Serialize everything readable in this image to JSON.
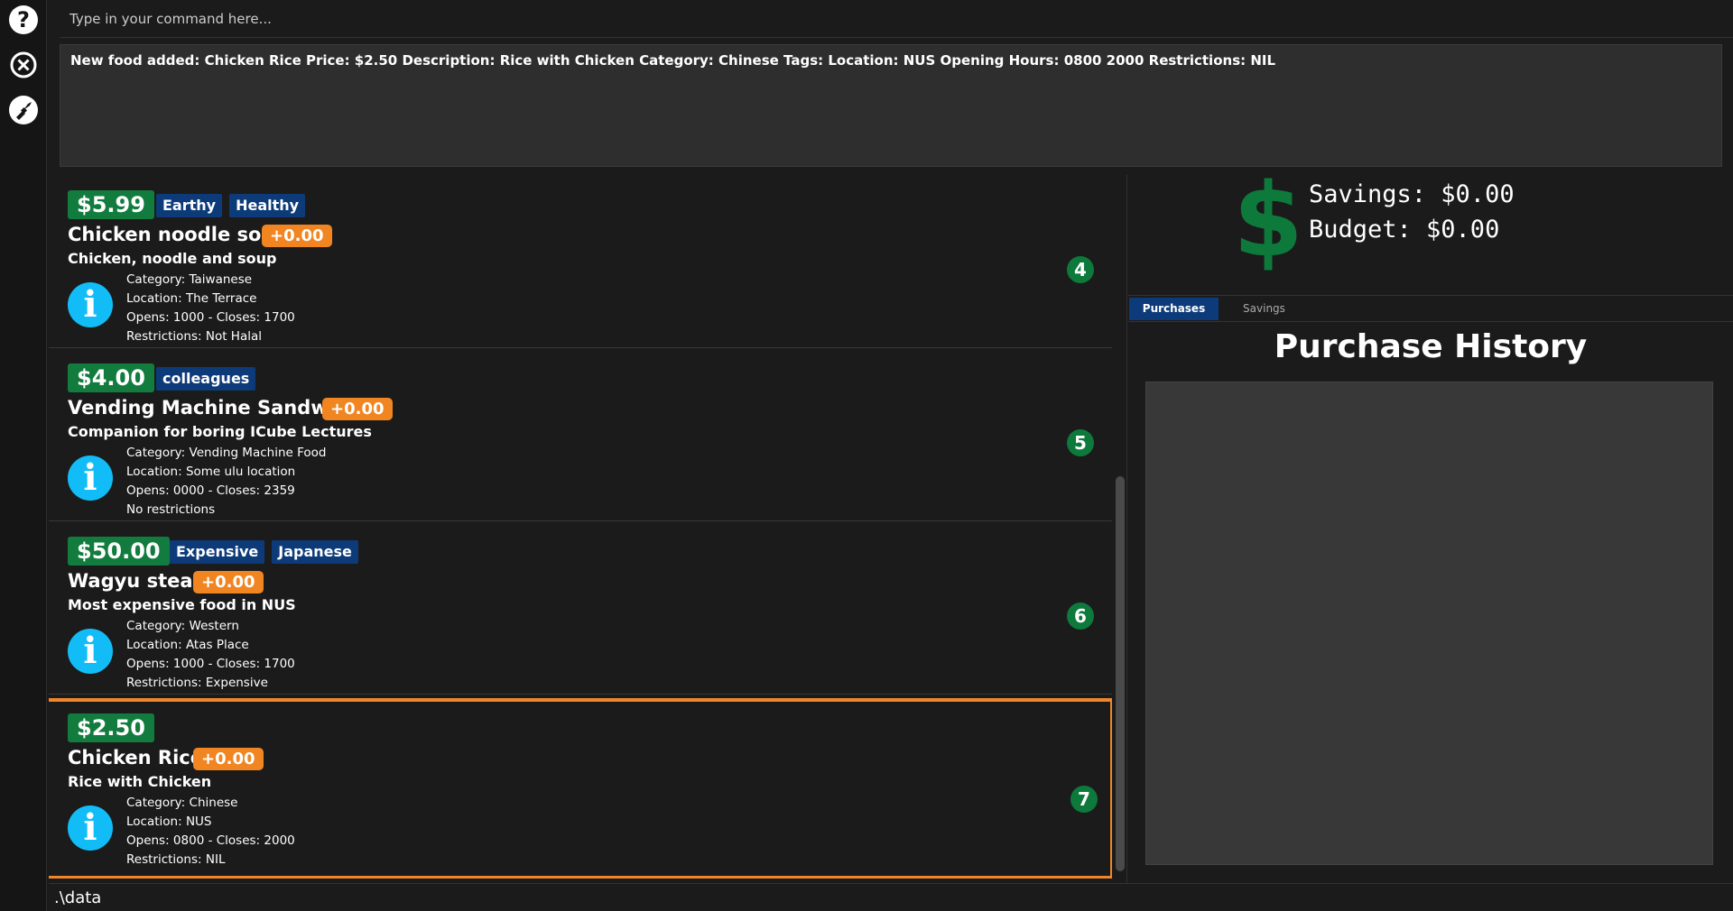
{
  "sidebar": {
    "help_glyph": "?",
    "icons": [
      "help-icon",
      "exit-icon",
      "theme-icon"
    ]
  },
  "command": {
    "placeholder": "Type in your command here..."
  },
  "result": {
    "text": "New food added: Chicken Rice Price: $2.50 Description: Rice with Chicken Category: Chinese Tags:  Location: NUS Opening Hours: 0800 2000 Restrictions: NIL"
  },
  "food_list": [
    {
      "price": "$5.99",
      "tags": [
        "Earthy",
        "Healthy"
      ],
      "name": "Chicken noodle soup",
      "delta": "+0.00",
      "description": "Chicken, noodle and soup",
      "category": "Category: Taiwanese",
      "location": "Location: The Terrace",
      "hours": "Opens: 1000 - Closes: 1700",
      "restrictions": "Restrictions: Not Halal",
      "index": "4"
    },
    {
      "price": "$4.00",
      "tags": [
        "colleagues"
      ],
      "name": "Vending Machine Sandwich",
      "delta": "+0.00",
      "description": "Companion for boring ICube Lectures",
      "category": "Category: Vending Machine Food",
      "location": "Location: Some ulu location",
      "hours": "Opens: 0000 - Closes: 2359",
      "restrictions": "No restrictions",
      "index": "5"
    },
    {
      "price": "$50.00",
      "tags": [
        "Expensive",
        "Japanese"
      ],
      "name": "Wagyu steak",
      "delta": "+0.00",
      "description": "Most expensive food in NUS",
      "category": "Category: Western",
      "location": "Location: Atas Place",
      "hours": "Opens: 1000 - Closes: 1700",
      "restrictions": "Restrictions: Expensive",
      "index": "6"
    },
    {
      "price": "$2.50",
      "tags": [],
      "name": "Chicken Rice",
      "delta": "+0.00",
      "description": "Rice with Chicken",
      "category": "Category: Chinese",
      "location": "Location: NUS",
      "hours": "Opens: 0800 - Closes: 2000",
      "restrictions": "Restrictions: NIL",
      "index": "7",
      "selected": true
    }
  ],
  "info_glyph": "i",
  "wallet": {
    "dollar_sign": "$",
    "savings": "Savings: $0.00",
    "budget": "Budget: $0.00"
  },
  "tabs": {
    "purchases": "Purchases",
    "savings": "Savings"
  },
  "history": {
    "title": "Purchase History"
  },
  "status": {
    "path": ".\\data"
  },
  "colors": {
    "price_green": "#127c3e",
    "tag_blue": "#0d3b7a",
    "delta_orange": "#f08521",
    "info_cyan": "#12bdf7",
    "selection_orange": "#f0862a"
  }
}
